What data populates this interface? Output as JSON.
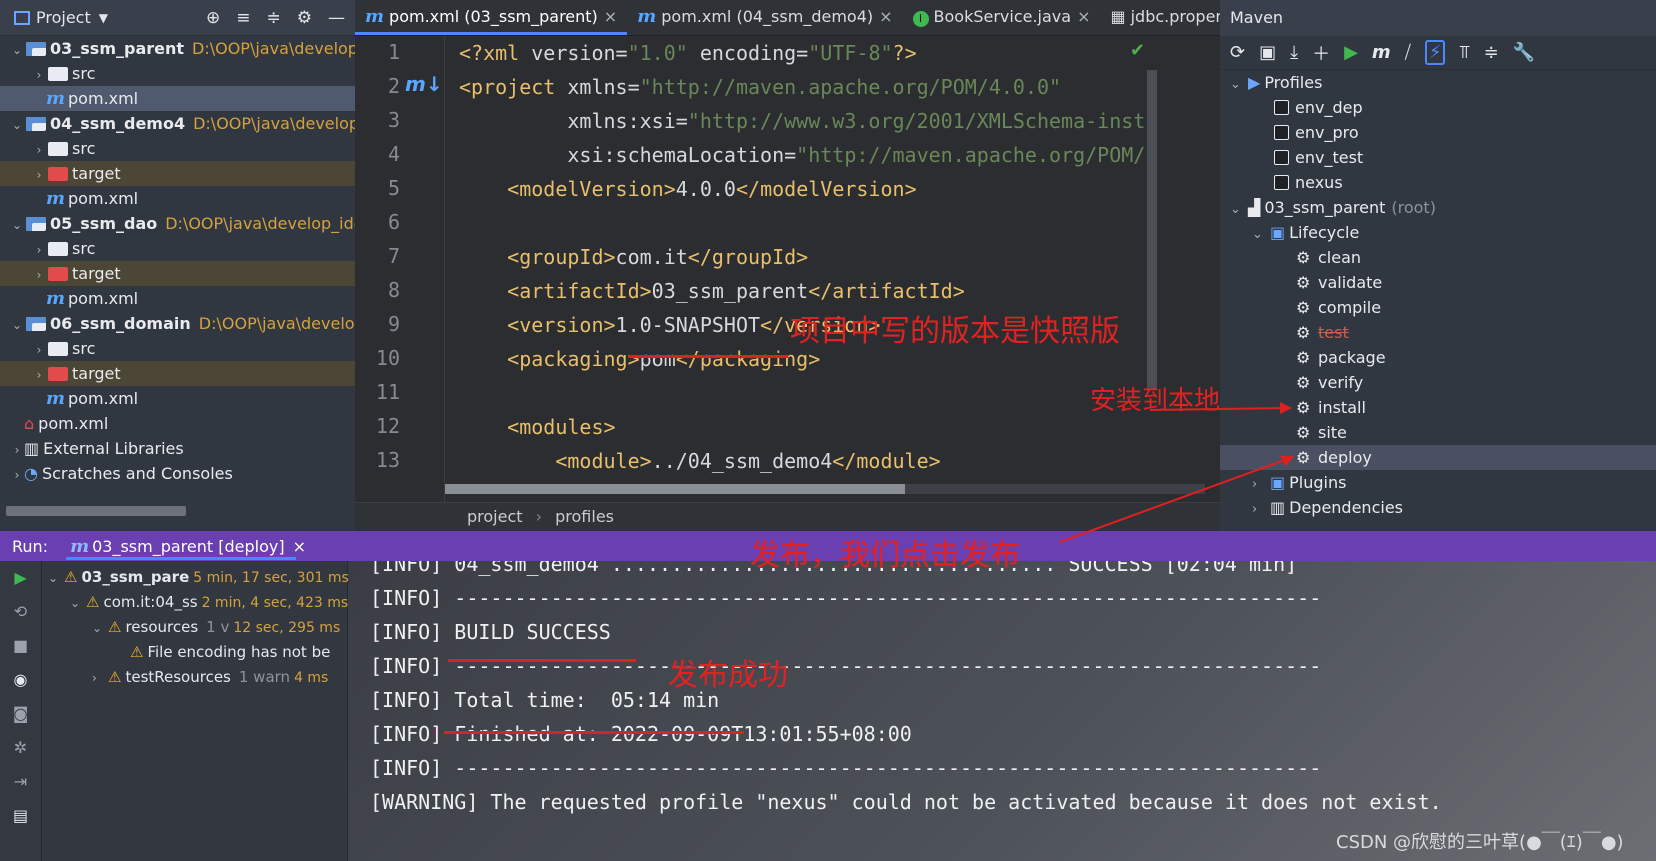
{
  "project_panel": {
    "title": "Project",
    "tree": [
      {
        "name": "03_ssm_parent",
        "path": "D:\\OOP\\java\\develop_",
        "kind": "module",
        "bold": true
      },
      {
        "name": "src",
        "kind": "folder"
      },
      {
        "name": "pom.xml",
        "kind": "pom",
        "selected": true
      },
      {
        "name": "04_ssm_demo4",
        "path": "D:\\OOP\\java\\develop_",
        "kind": "module",
        "bold": true
      },
      {
        "name": "src",
        "kind": "folder"
      },
      {
        "name": "target",
        "kind": "target"
      },
      {
        "name": "pom.xml",
        "kind": "pom"
      },
      {
        "name": "05_ssm_dao",
        "path": "D:\\OOP\\java\\develop_ide",
        "kind": "module",
        "bold": true
      },
      {
        "name": "src",
        "kind": "folder"
      },
      {
        "name": "target",
        "kind": "target"
      },
      {
        "name": "pom.xml",
        "kind": "pom"
      },
      {
        "name": "06_ssm_domain",
        "path": "D:\\OOP\\java\\develop",
        "kind": "module",
        "bold": true
      },
      {
        "name": "src",
        "kind": "folder"
      },
      {
        "name": "target",
        "kind": "target"
      },
      {
        "name": "pom.xml",
        "kind": "pom"
      },
      {
        "name": "pom.xml",
        "kind": "pom-root"
      },
      {
        "name": "External Libraries",
        "kind": "libs"
      },
      {
        "name": "Scratches and Consoles",
        "kind": "scratch"
      }
    ]
  },
  "editor": {
    "tabs": [
      {
        "label": "pom.xml (03_ssm_parent)",
        "icon": "maven-icon",
        "active": true
      },
      {
        "label": "pom.xml (04_ssm_demo4)",
        "icon": "maven-icon"
      },
      {
        "label": "BookService.java",
        "icon": "interface-icon"
      },
      {
        "label": "jdbc.properties",
        "icon": "properties-icon"
      }
    ],
    "line_numbers": [
      "1",
      "2",
      "3",
      "4",
      "5",
      "6",
      "7",
      "8",
      "9",
      "10",
      "11",
      "12",
      "13"
    ],
    "lines": [
      "<?xml version=\"1.0\" encoding=\"UTF-8\"?>",
      "<project xmlns=\"http://maven.apache.org/POM/4.0.0\"",
      "         xmlns:xsi=\"http://www.w3.org/2001/XMLSchema-inst",
      "         xsi:schemaLocation=\"http://maven.apache.org/POM/",
      "    <modelVersion>4.0.0</modelVersion>",
      "",
      "    <groupId>com.it</groupId>",
      "    <artifactId>03_ssm_parent</artifactId>",
      "    <version>1.0-SNAPSHOT</version>",
      "    <packaging>pom</packaging>",
      "",
      "    <modules>",
      "        <module>../04_ssm_demo4</module>"
    ],
    "breadcrumb": [
      "project",
      "profiles"
    ]
  },
  "maven": {
    "title": "Maven",
    "profiles_label": "Profiles",
    "profiles": [
      "env_dep",
      "env_pro",
      "env_test",
      "nexus"
    ],
    "root_label": "03_ssm_parent",
    "root_suffix": "(root)",
    "lifecycle_label": "Lifecycle",
    "lifecycle": [
      "clean",
      "validate",
      "compile",
      "test",
      "package",
      "verify",
      "install",
      "site",
      "deploy"
    ],
    "plugins_label": "Plugins",
    "dependencies_label": "Dependencies"
  },
  "run": {
    "label": "Run:",
    "tab": "03_ssm_parent [deploy]",
    "tree": [
      {
        "name": "03_ssm_pare",
        "time": "5 min, 17 sec, 301 ms"
      },
      {
        "name": "com.it:04_ss",
        "time": "2 min, 4 sec, 423 ms"
      },
      {
        "name": "resources",
        "extra": "1 v",
        "time": "12 sec, 295 ms"
      },
      {
        "name": "File encoding has not be",
        "time": ""
      },
      {
        "name": "testResources",
        "extra": "1 warn",
        "time": "4 ms"
      }
    ],
    "console": [
      "[INFO] 04_ssm_demo4 ..................................... SUCCESS [02:04 min]",
      "[INFO] ------------------------------------------------------------------------",
      "[INFO] BUILD SUCCESS",
      "[INFO] ------------------------------------------------------------------------",
      "[INFO] Total time:  05:14 min",
      "[INFO] Finished at: 2022-09-09T13:01:55+08:00",
      "[INFO] ------------------------------------------------------------------------",
      "[WARNING] The requested profile \"nexus\" could not be activated because it does not exist."
    ]
  },
  "annotations": {
    "snapshot": "项目中写的版本是快照版",
    "install": "安装到本地",
    "deploy": "发布，我们点击发布",
    "success": "发布成功"
  },
  "watermark": "CSDN @欣慰的三叶草(●￣(ｴ)￣●)",
  "colors": {
    "accent": "#4a88ff",
    "run_bar": "#6a3fb1",
    "annotation": "#e22222",
    "xml_tag": "#e8bf6a",
    "xml_value": "#6a8759"
  }
}
